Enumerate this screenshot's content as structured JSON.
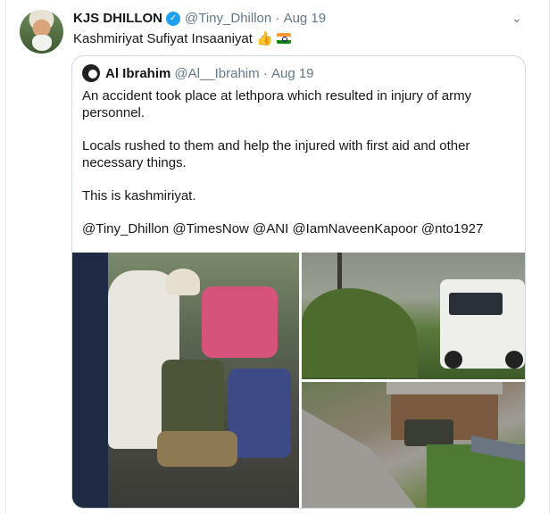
{
  "tweet": {
    "author_name": "KJS DHILLON",
    "handle": "@Tiny_Dhillon",
    "date": "Aug 19",
    "text": "Kashmiriyat Sufiyat Insaaniyat",
    "emojis": [
      "thumbs-up",
      "india-flag"
    ]
  },
  "quoted_tweet": {
    "author_name": "Al Ibrahim",
    "handle": "@Al__Ibrahim",
    "date": "Aug 19",
    "paragraphs": [
      "An accident took place at lethpora which resulted in injury of army personnel.",
      "Locals rushed to them and help the injured with first aid and other necessary things.",
      "This is kashmiriyat.",
      "@Tiny_Dhillon @TimesNow @ANI @IamNaveenKapoor @nto1927"
    ],
    "media": [
      {
        "name": "locals-helping-injured-soldier-photo"
      },
      {
        "name": "army-vehicle-on-road-photo"
      },
      {
        "name": "crashed-vehicle-slope-photo"
      }
    ]
  },
  "colors": {
    "text": "#14171a",
    "muted": "#657786",
    "verified": "#1da1f2",
    "border": "#ccd6dd"
  },
  "icons": {
    "verified": "verified-badge-icon",
    "menu": "chevron-down-icon"
  }
}
